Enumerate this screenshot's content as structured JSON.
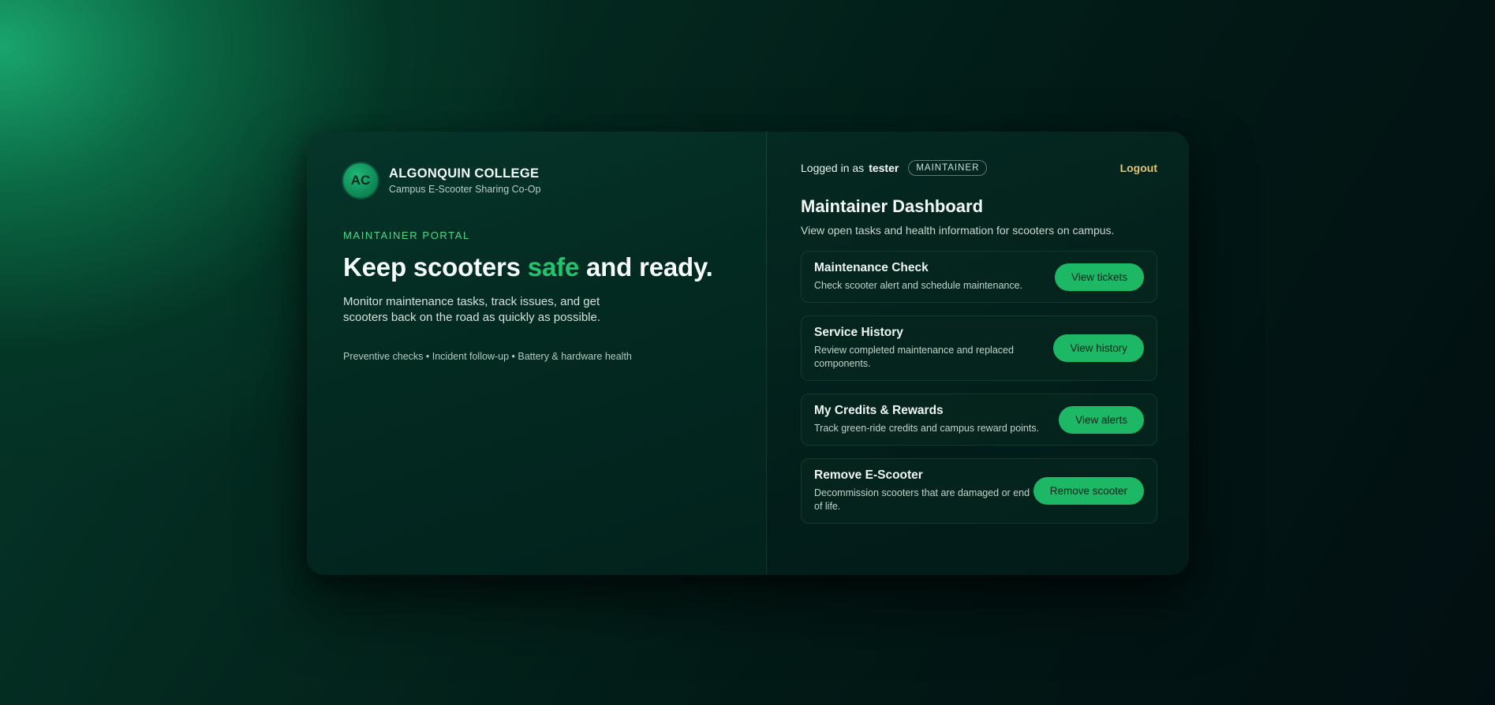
{
  "brand": {
    "initials": "AC",
    "name": "ALGONQUIN COLLEGE",
    "subtitle": "Campus E-Scooter Sharing Co-Op"
  },
  "left": {
    "portal_label": "MAINTAINER PORTAL",
    "hero_before": "Keep scooters ",
    "hero_accent": "safe",
    "hero_after": " and ready.",
    "description": "Monitor maintenance tasks, track issues, and get scooters back on the road as quickly as possible.",
    "features": "Preventive checks • Incident follow-up • Battery & hardware health"
  },
  "header": {
    "logged_prefix": "Logged in as",
    "username": "tester",
    "role": "MAINTAINER",
    "logout_label": "Logout"
  },
  "dashboard": {
    "title": "Maintainer Dashboard",
    "subtitle": "View open tasks and health information for scooters on campus.",
    "tasks": [
      {
        "title": "Maintenance Check",
        "description": "Check scooter alert and schedule maintenance.",
        "button": "View tickets"
      },
      {
        "title": "Service History",
        "description": "Review completed maintenance and replaced components.",
        "button": "View history"
      },
      {
        "title": "My Credits & Rewards",
        "description": "Track green-ride credits and campus reward points.",
        "button": "View alerts"
      },
      {
        "title": "Remove E-Scooter",
        "description": "Decommission scooters that are damaged or end of life.",
        "button": "Remove scooter"
      }
    ]
  },
  "colors": {
    "accent": "#22c46f",
    "button": "#1db866",
    "logout": "#e4c471"
  }
}
